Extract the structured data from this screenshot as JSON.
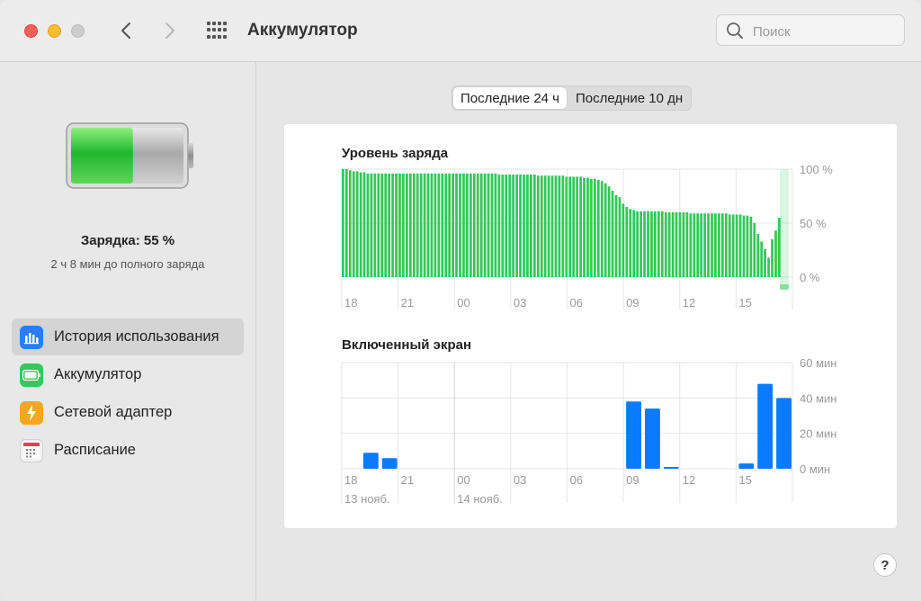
{
  "window": {
    "title": "Аккумулятор",
    "search_placeholder": "Поиск"
  },
  "sidebar": {
    "charge_label": "Зарядка: 55 %",
    "charge_level": 0.55,
    "time_to_full": "2 ч 8 мин до полного заряда",
    "items": [
      {
        "label": "История использования",
        "icon": "chart-icon",
        "color": "#2d7bf6",
        "active": true
      },
      {
        "label": "Аккумулятор",
        "icon": "battery-icon",
        "color": "#38c759",
        "active": false
      },
      {
        "label": "Сетевой адаптер",
        "icon": "lightning-icon",
        "color": "#f5a623",
        "active": false
      },
      {
        "label": "Расписание",
        "icon": "calendar-icon",
        "color": "#e84235",
        "active": false
      }
    ]
  },
  "tabs": [
    {
      "label": "Последние 24 ч",
      "active": true
    },
    {
      "label": "Последние 10 дн",
      "active": false
    }
  ],
  "colors": {
    "battery_green": "#33c759",
    "screen_blue": "#0a7aff"
  },
  "chart_data": [
    {
      "type": "bar",
      "title": "Уровень заряда",
      "x_tick_labels": [
        "18",
        "21",
        "00",
        "03",
        "06",
        "09",
        "12",
        "15"
      ],
      "y_tick_labels": [
        "100 %",
        "50 %",
        "0 %"
      ],
      "ylim": [
        0,
        100
      ],
      "values": [
        100,
        100,
        99,
        98,
        98,
        97,
        97,
        96,
        96,
        96,
        96,
        96,
        96,
        96,
        96,
        96,
        96,
        96,
        96,
        96,
        96,
        96,
        96,
        96,
        96,
        96,
        96,
        96,
        96,
        96,
        96,
        96,
        96,
        96,
        96,
        96,
        96,
        96,
        96,
        96,
        96,
        96,
        96,
        96,
        95,
        95,
        95,
        95,
        95,
        95,
        95,
        95,
        95,
        95,
        95,
        94,
        94,
        94,
        94,
        94,
        94,
        94,
        94,
        93,
        93,
        93,
        93,
        93,
        92,
        92,
        91,
        91,
        90,
        89,
        87,
        84,
        80,
        76,
        74,
        68,
        65,
        63,
        62,
        61,
        61,
        61,
        61,
        61,
        61,
        61,
        61,
        60,
        60,
        60,
        60,
        60,
        60,
        60,
        59,
        59,
        59,
        59,
        59,
        59,
        59,
        59,
        59,
        59,
        59,
        58,
        58,
        58,
        58,
        57,
        57,
        56,
        50,
        40,
        33,
        26,
        18,
        35,
        43,
        55
      ],
      "charging_highlight": "last interval"
    },
    {
      "type": "bar",
      "title": "Включенный экран",
      "x_tick_labels": [
        "18",
        "21",
        "00",
        "03",
        "06",
        "09",
        "12",
        "15"
      ],
      "date_labels": [
        "13 нояб.",
        "14 нояб."
      ],
      "y_tick_labels": [
        "60 мин",
        "40 мин",
        "20 мин",
        "0 мин"
      ],
      "ylim": [
        0,
        60
      ],
      "unit": "мин",
      "hours": [
        "18",
        "19",
        "20",
        "21",
        "22",
        "23",
        "00",
        "01",
        "02",
        "03",
        "04",
        "05",
        "06",
        "07",
        "08",
        "09",
        "10",
        "11",
        "12",
        "13",
        "14",
        "15",
        "16",
        "17"
      ],
      "values": [
        0,
        9,
        6,
        0,
        0,
        0,
        0,
        0,
        0,
        0,
        0,
        0,
        0,
        0,
        0,
        38,
        34,
        1,
        0,
        0,
        0,
        3,
        48,
        40
      ]
    }
  ]
}
